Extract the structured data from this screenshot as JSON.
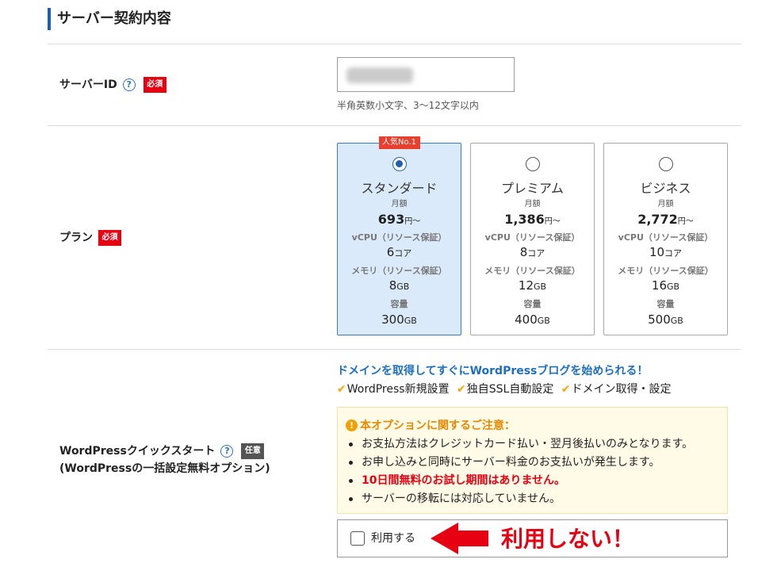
{
  "section": {
    "title": "サーバー契約内容"
  },
  "server_id": {
    "label": "サーバーID",
    "help_icon": "question-circle-icon",
    "required_badge": "必須",
    "hint": "半角英数小文字、3〜12文字以内"
  },
  "plan": {
    "label": "プラン",
    "required_badge": "必須",
    "selected_index": 0,
    "cards": [
      {
        "name": "スタンダード",
        "badge": "人気No.1",
        "price_label": "月額",
        "price": "693",
        "price_unit": "円〜",
        "vcpu_label": "vCPU（リソース保証）",
        "vcpu": "6",
        "vcpu_unit": "コア",
        "memory_label": "メモリ（リソース保証）",
        "memory": "8",
        "memory_unit": "GB",
        "storage_label": "容量",
        "storage": "300",
        "storage_unit": "GB"
      },
      {
        "name": "プレミアム",
        "price_label": "月額",
        "price": "1,386",
        "price_unit": "円〜",
        "vcpu_label": "vCPU（リソース保証）",
        "vcpu": "8",
        "vcpu_unit": "コア",
        "memory_label": "メモリ（リソース保証）",
        "memory": "12",
        "memory_unit": "GB",
        "storage_label": "容量",
        "storage": "400",
        "storage_unit": "GB"
      },
      {
        "name": "ビジネス",
        "price_label": "月額",
        "price": "2,772",
        "price_unit": "円〜",
        "vcpu_label": "vCPU（リソース保証）",
        "vcpu": "10",
        "vcpu_unit": "コア",
        "memory_label": "メモリ（リソース保証）",
        "memory": "16",
        "memory_unit": "GB",
        "storage_label": "容量",
        "storage": "500",
        "storage_unit": "GB"
      }
    ]
  },
  "quickstart": {
    "label": "WordPressクイックスタート",
    "sublabel": "(WordPressの一括設定無料オプション)",
    "help_icon": "question-circle-icon",
    "optional_badge": "任意",
    "promo": "ドメインを取得してすぐにWordPressブログを始められる！",
    "feature_icon": "check-icon",
    "features": [
      "WordPress新規設置",
      "独自SSL自動設定",
      "ドメイン取得・設定"
    ],
    "notice": {
      "icon": "exclamation-circle-icon",
      "title": "本オプションに関するご注意：",
      "items": [
        {
          "text": "お支払方法はクレジットカード払い・翌月後払いのみとなります。",
          "emphasis": false
        },
        {
          "text": "お申し込みと同時にサーバー料金のお支払いが発生します。",
          "emphasis": false
        },
        {
          "text": "10日間無料のお試し期間はありません。",
          "emphasis": true
        },
        {
          "text": "サーバーの移転には対応していません。",
          "emphasis": false
        }
      ]
    },
    "option": {
      "label": "利用する",
      "checked": false
    }
  },
  "annotation": {
    "text": "利用しない！",
    "arrow_icon": "red-left-arrow-icon"
  },
  "colors": {
    "accent_blue": "#1f5fae",
    "required_red": "#e60012",
    "optional_gray": "#555555",
    "selected_card_bg": "#dbeafa",
    "promo_blue": "#1e6fc0",
    "check_orange": "#f5a300",
    "notice_bg": "#fffbe7",
    "notice_title": "#e58a00",
    "annotation_red": "#e60012"
  }
}
